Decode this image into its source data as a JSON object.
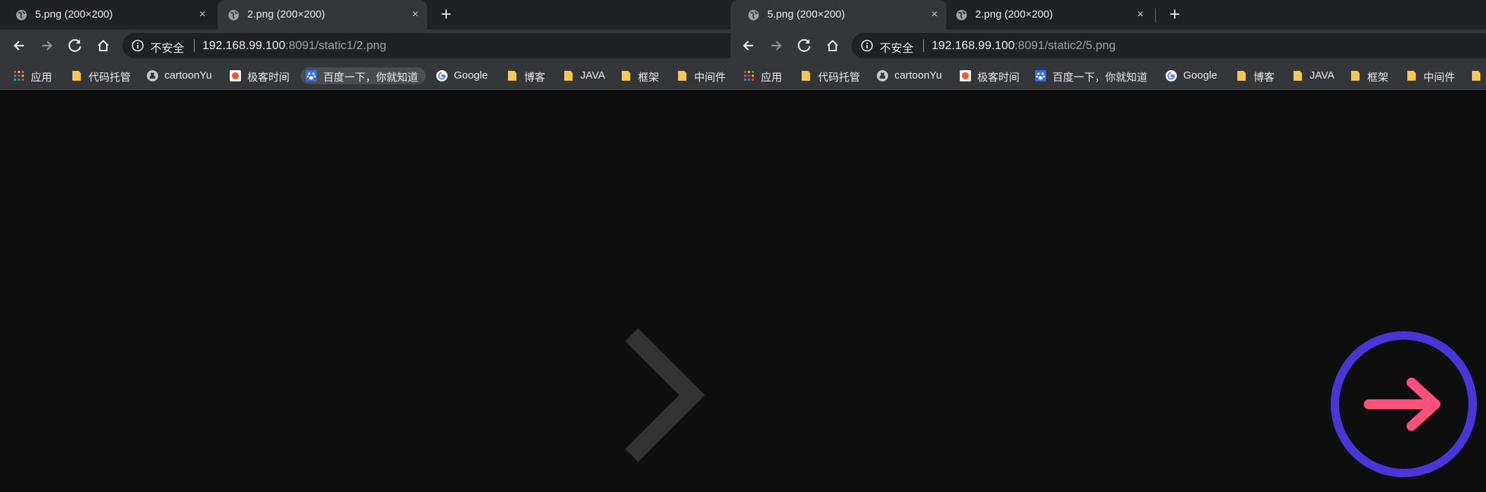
{
  "left_window": {
    "tabs": [
      {
        "title": "5.png (200×200)",
        "active": false,
        "close": "×"
      },
      {
        "title": "2.png (200×200)",
        "active": true,
        "close": "×"
      }
    ],
    "new_tab": "+",
    "address": {
      "insecure_label": "不安全",
      "host": "192.168.99.100",
      "rest": ":8091/static1/2.png"
    },
    "bookmarks": [
      "应用",
      "代码托管",
      "cartoonYu",
      "极客时间",
      "百度一下，你就知道",
      "Google",
      "博客",
      "JAVA",
      "框架",
      "中间件"
    ]
  },
  "right_window": {
    "tabs": [
      {
        "title": "5.png (200×200)",
        "active": true,
        "close": "×"
      },
      {
        "title": "2.png (200×200)",
        "active": false,
        "close": "×"
      }
    ],
    "new_tab": "+",
    "address": {
      "insecure_label": "不安全",
      "host": "192.168.99.100",
      "rest": ":8091/static2/5.png"
    },
    "bookmarks": [
      "应用",
      "代码托管",
      "cartoonYu",
      "极客时间",
      "百度一下，你就知道",
      "Google",
      "博客",
      "JAVA",
      "框架",
      "中间件"
    ]
  },
  "colors": {
    "chevron": "#333333",
    "ring": "#4a35d8",
    "arrow": "#ff4f7b",
    "folder": "#f6c94e"
  }
}
